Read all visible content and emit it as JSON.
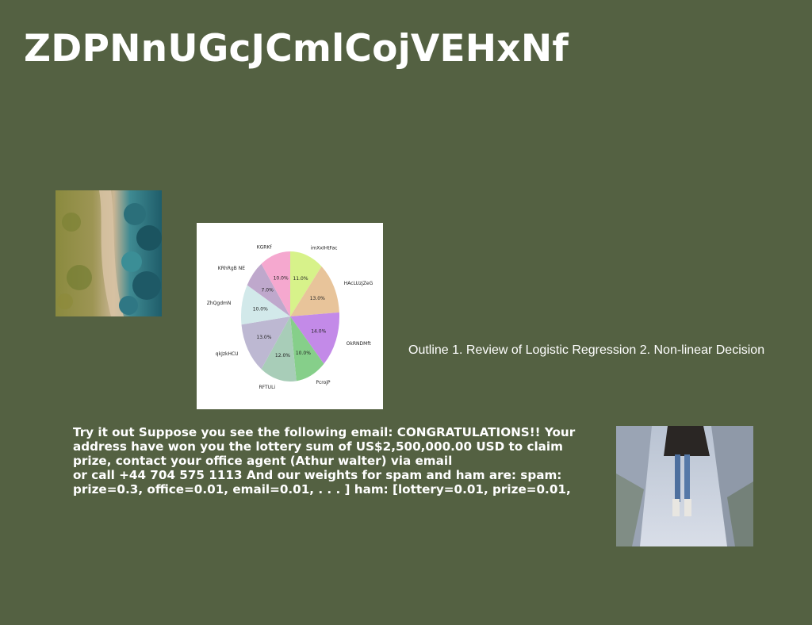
{
  "slide": {
    "title": "ZDPNnUGcJCmlCojVEHxNf",
    "outline_text": "Outline 1. Review of Logistic Regression 2. Non-linear Decision",
    "body_lines": [
      "Try it out Suppose you see the following email: CONGRATULATIONS!! Your",
      "address have won you the lottery sum of US$2,500,000.00 USD to claim",
      "prize, contact your office agent (Athur walter) via email",
      "or call +44 704 575 1113 And our weights for spam and ham are: spam:",
      "prize=0.3, office=0.01, email=0.01, . . . ] ham: [lottery=0.01, prize=0.01,"
    ]
  },
  "colors": {
    "background": "#546142",
    "text": "#ffffff"
  },
  "images": {
    "landscape_photo": "aerial-coastline-photo",
    "person_photo": "person-on-snowy-path-photo"
  },
  "chart_data": {
    "type": "pie",
    "title": "",
    "slices": [
      {
        "label": "imXxIHtFac",
        "value": 11.0,
        "pct_label": "11.0%",
        "color": "#d7f28a"
      },
      {
        "label": "HAcLUzjZeG",
        "value": 13.0,
        "pct_label": "13.0%",
        "color": "#e8c49a"
      },
      {
        "label": "OkRNDMft",
        "value": 14.0,
        "pct_label": "14.0%",
        "color": "#c38ae8"
      },
      {
        "label": "PcrojP",
        "value": 10.0,
        "pct_label": "10.0%",
        "color": "#86cf8a"
      },
      {
        "label": "RFTULi",
        "value": 12.0,
        "pct_label": "12.0%",
        "color": "#a8cdb8"
      },
      {
        "label": "qkJzkHCU",
        "value": 13.0,
        "pct_label": "13.0%",
        "color": "#bdb8d2"
      },
      {
        "label": "ZhQgdmN",
        "value": 10.0,
        "pct_label": "10.0%",
        "color": "#d2e9ea"
      },
      {
        "label": "KRhRgB NE",
        "value": 7.0,
        "pct_label": "7.0%",
        "color": "#bfa8cc"
      },
      {
        "label": "KGRKf",
        "value": 10.0,
        "pct_label": "10.0%",
        "color": "#f5a8cf"
      }
    ]
  }
}
